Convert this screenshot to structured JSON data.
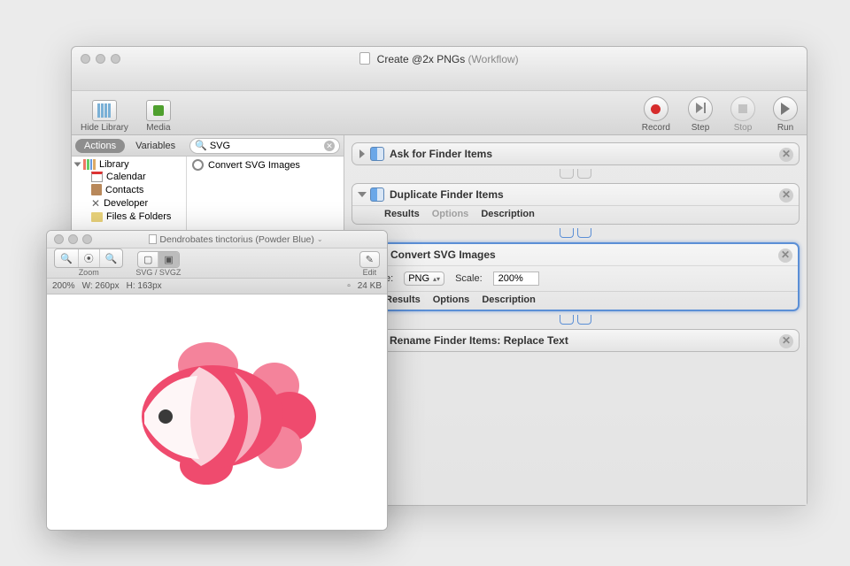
{
  "automator": {
    "window_title_prefix": "Create @2x PNGs",
    "window_title_suffix": "(Workflow)",
    "toolbar": {
      "hide_library": "Hide Library",
      "media": "Media",
      "record": "Record",
      "step": "Step",
      "stop": "Stop",
      "run": "Run"
    },
    "sidebar": {
      "tabs": {
        "actions": "Actions",
        "variables": "Variables"
      },
      "search_value": "SVG",
      "library_label": "Library",
      "categories": [
        "Calendar",
        "Contacts",
        "Developer",
        "Files & Folders"
      ],
      "results": [
        "Convert SVG Images"
      ]
    },
    "workflow": {
      "tabs": {
        "results": "Results",
        "options": "Options",
        "description": "Description"
      },
      "steps": [
        {
          "title": "Ask for Finder Items",
          "expanded": false,
          "kind": "finder"
        },
        {
          "title": "Duplicate Finder Items",
          "expanded": true,
          "kind": "finder"
        },
        {
          "title": "Convert SVG Images",
          "expanded": true,
          "selected": true,
          "kind": "svg",
          "fields": {
            "type_label": "e:",
            "type_value": "PNG",
            "scale_label": "Scale:",
            "scale_value": "200%"
          }
        },
        {
          "title": "Rename Finder Items: Replace Text",
          "expanded": false,
          "kind": "finder"
        }
      ]
    }
  },
  "preview": {
    "title": "Dendrobates tinctorius (Powder Blue)",
    "toolbar": {
      "zoom_label": "Zoom",
      "mode_label": "SVG / SVGZ",
      "edit_label": "Edit"
    },
    "status": {
      "zoom": "200%",
      "w": "W: 260px",
      "h": "H: 163px",
      "size": "24 KB"
    }
  }
}
